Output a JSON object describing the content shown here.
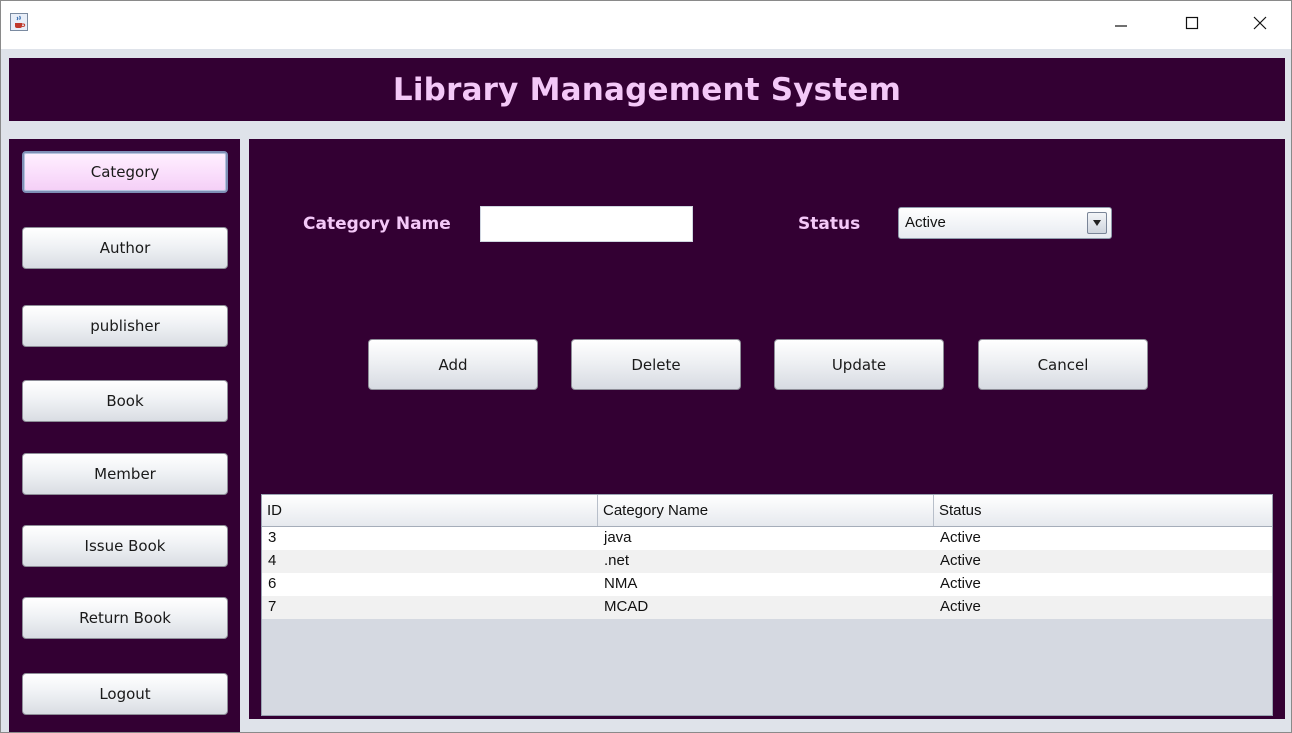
{
  "window": {
    "app_icon": "java-cup-icon",
    "controls": {
      "minimize": "minimize-icon",
      "maximize": "maximize-icon",
      "close": "close-icon"
    }
  },
  "header": {
    "title": "Library Management System"
  },
  "sidebar": {
    "items": [
      {
        "label": "Category",
        "active": true
      },
      {
        "label": "Author"
      },
      {
        "label": "publisher"
      },
      {
        "label": "Book"
      },
      {
        "label": "Member"
      },
      {
        "label": "Issue Book"
      },
      {
        "label": "Return Book"
      },
      {
        "label": "Logout"
      }
    ]
  },
  "form": {
    "category_name_label": "Category Name",
    "category_name_value": "",
    "status_label": "Status",
    "status_selected": "Active"
  },
  "actions": {
    "add": "Add",
    "delete": "Delete",
    "update": "Update",
    "cancel": "Cancel"
  },
  "table": {
    "columns": [
      "ID",
      "Category Name",
      "Status"
    ],
    "rows": [
      [
        "3",
        "java",
        "Active"
      ],
      [
        "4",
        ".net",
        "Active"
      ],
      [
        "6",
        "NMA",
        "Active"
      ],
      [
        "7",
        "MCAD",
        "Active"
      ]
    ]
  },
  "colors": {
    "panel_bg": "#330033",
    "accent_text": "#f4c8f8",
    "active_button": "#f9dcfb"
  }
}
